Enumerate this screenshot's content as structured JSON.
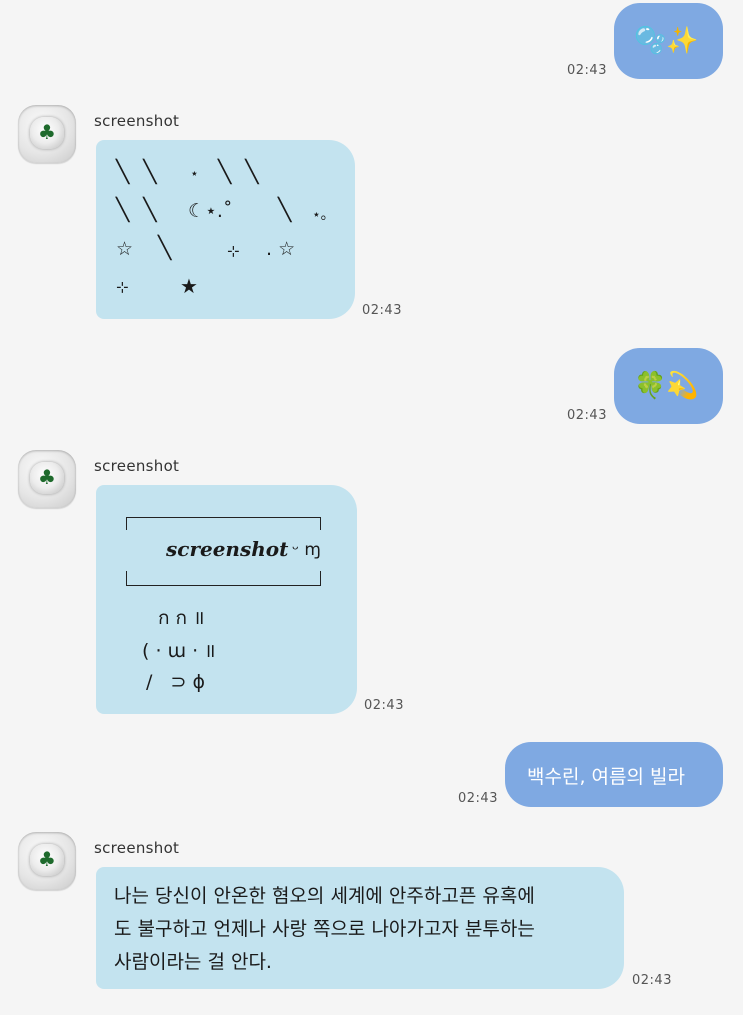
{
  "messages": [
    {
      "dir": "out",
      "content": "🫧✨",
      "time": "02:43"
    },
    {
      "dir": "in",
      "sender": "screenshot",
      "time": "02:43",
      "art": {
        "row1_slashes_a": "╲  ╲",
        "row1_star": "⋆",
        "row1_slashes_b": "╲  ╲",
        "row2_slashes": "╲  ╲",
        "row2_moon": "☾⋆.˚",
        "row2_slash": "╲",
        "row2_tail": "⋆｡",
        "row3_star": "☆",
        "row3_slash": "╲",
        "row3_sparkle": "⊹",
        "row3_dot_star": ". ☆",
        "row4_sparkle": "⊹",
        "row4_star": "★"
      }
    },
    {
      "dir": "out",
      "content": "🍀💫",
      "time": "02:43"
    },
    {
      "dir": "in",
      "sender": "screenshot",
      "time": "02:43",
      "art": {
        "name": "screenshot",
        "face": "ᵕ ɱ",
        "line1": "ก ก ॥",
        "line2": "( · ɯ · ॥",
        "line3": "/   ⊃ ɸ"
      }
    },
    {
      "dir": "out",
      "content": "백수린, 여름의 빌라",
      "time": "02:43"
    },
    {
      "dir": "in",
      "sender": "screenshot",
      "time": "02:43",
      "lines": [
        "나는 당신이 안온한 혐오의 세계에 안주하고픈 유혹에",
        "도 불구하고 언제나 사랑 쪽으로 나아가고자 분투하는",
        "사람이라는 걸 안다."
      ]
    }
  ],
  "icons": {
    "avatar": "clover-heart-avatar-icon"
  },
  "colors": {
    "outgoing": "#7fa9e2",
    "incoming": "#c3e3ef",
    "background": "#f5f5f5"
  }
}
